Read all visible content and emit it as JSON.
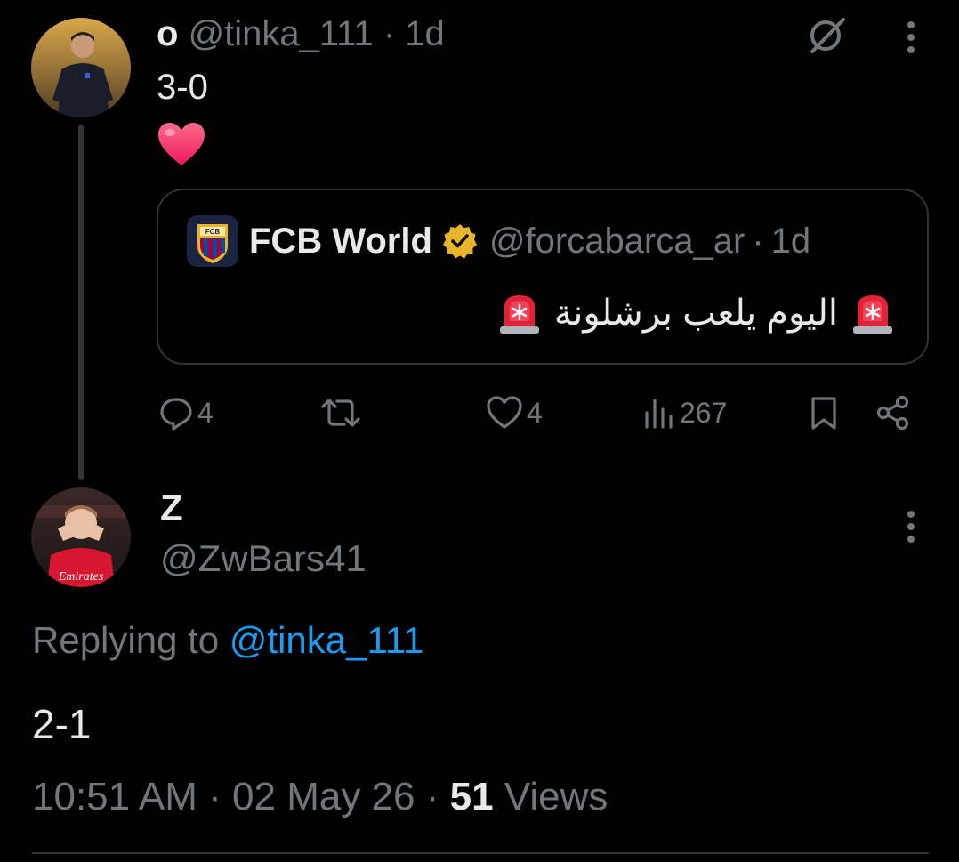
{
  "parent_tweet": {
    "display_name": "o",
    "handle": "@tinka_111",
    "separator": "·",
    "time": "1d",
    "text": "3-0",
    "emoji": "❤️",
    "quote": {
      "display_name": "FCB World",
      "handle": "@forcabarca_ar",
      "time": "1d",
      "text": "اليوم يلعب برشلونة"
    },
    "actions": {
      "replies": "4",
      "likes": "4",
      "views": "267"
    }
  },
  "reply_tweet": {
    "display_name": "Z",
    "handle": "@ZwBars41",
    "replying_label": "Replying to",
    "replying_handle": "@tinka_111",
    "text": "2-1",
    "time": "10:51 AM",
    "date": "02 May 26",
    "views_count": "51",
    "views_label": "Views"
  },
  "colors": {
    "background": "#000000",
    "text_primary": "#e7e9ea",
    "text_muted": "#71767b",
    "link": "#1d9bf0",
    "border": "#2f3336",
    "verified_gold": "#e8b42a"
  }
}
